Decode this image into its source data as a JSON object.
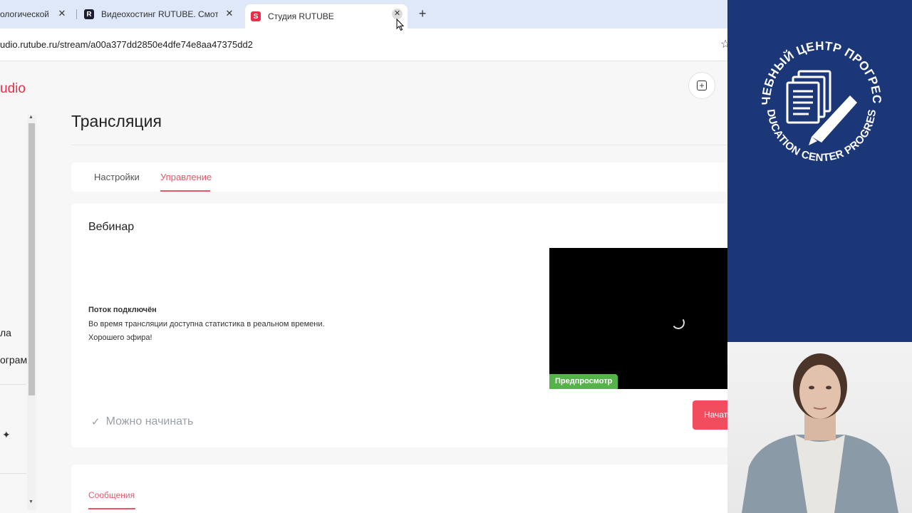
{
  "browser": {
    "tabs": [
      {
        "label": "ологической ·",
        "active": false
      },
      {
        "label": "Видеохостинг RUTUBE. Смотрі",
        "active": false,
        "favicon": "R"
      },
      {
        "label": "Студия RUTUBE",
        "active": true,
        "favicon": "S"
      }
    ],
    "url": "udio.rutube.ru/stream/a00a377dd2850e4dfe74e8aa47375dd2"
  },
  "sidebar": {
    "logo": "udio",
    "items": [
      {
        "label": "ла"
      },
      {
        "label": "ограм"
      }
    ]
  },
  "page": {
    "title": "Трансляция",
    "tabs": [
      {
        "label": "Настройки",
        "active": false
      },
      {
        "label": "Управление",
        "active": true
      }
    ]
  },
  "webinar": {
    "title": "Вебинар",
    "status_title": "Поток подключён",
    "status_lines": [
      "Во время трансляции доступна статистика в реальном времени.",
      "Хорошего эфира!"
    ],
    "preview_badge": "Предпросмотр",
    "ready_text": "Можно начинать",
    "start_button": "Начать"
  },
  "messages": {
    "tab_label": "Сообщения"
  },
  "overlay": {
    "emblem_top": "УЧЕБНЫЙ ЦЕНТР ПРОГРЕСС",
    "emblem_bottom": "EDUCATION CENTER PROGRESS"
  },
  "colors": {
    "accent": "#e8566a",
    "start_button": "#f14d5f",
    "preview_badge": "#55b34a",
    "panel": "#1c3778"
  }
}
